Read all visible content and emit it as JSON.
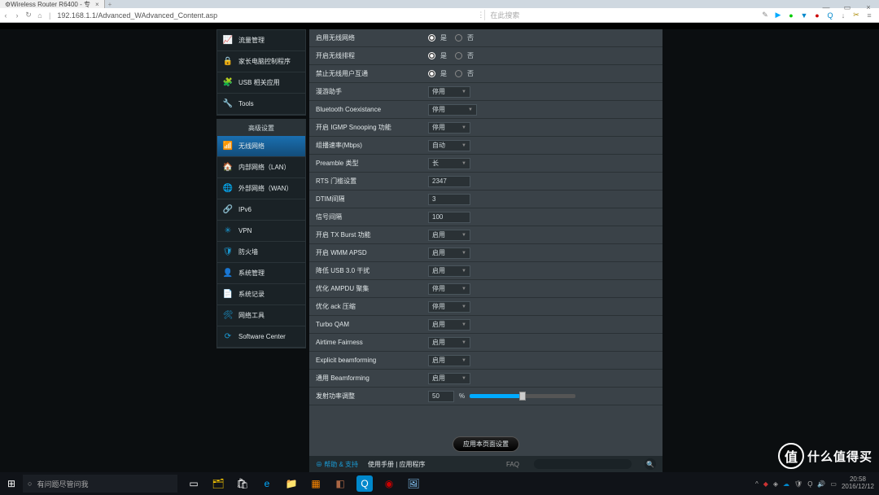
{
  "browser": {
    "tab_title": "Wireless Router R6400 - 专",
    "url": "192.168.1.1/Advanced_WAdvanced_Content.asp",
    "search_placeholder": "在此搜索"
  },
  "sidebar": {
    "group1": [
      {
        "icon": "📈",
        "label": "流量管理"
      },
      {
        "icon": "🔒",
        "label": "家长电脑控制程序"
      },
      {
        "icon": "🧩",
        "label": "USB 相关应用"
      },
      {
        "icon": "🔧",
        "label": "Tools"
      }
    ],
    "group2_header": "高级设置",
    "group2": [
      {
        "icon": "📶",
        "label": "无线网络",
        "active": true
      },
      {
        "icon": "🏠",
        "label": "内部网络（LAN）"
      },
      {
        "icon": "🌐",
        "label": "外部网络（WAN）"
      },
      {
        "icon": "🔗",
        "label": "IPv6"
      },
      {
        "icon": "✳",
        "label": "VPN"
      },
      {
        "icon": "🛡",
        "label": "防火墙"
      },
      {
        "icon": "👤",
        "label": "系统管理"
      },
      {
        "icon": "📄",
        "label": "系统记录"
      },
      {
        "icon": "🛠",
        "label": "网络工具"
      },
      {
        "icon": "⟳",
        "label": "Software Center"
      }
    ]
  },
  "settings": {
    "rows": [
      {
        "label": "启用无线网络",
        "type": "radio",
        "opts": [
          "是",
          "否"
        ],
        "sel": 0
      },
      {
        "label": "开启无线排程",
        "type": "radio",
        "opts": [
          "是",
          "否"
        ],
        "sel": 0
      },
      {
        "label": "禁止无线用户互通",
        "type": "radio",
        "opts": [
          "是",
          "否"
        ],
        "sel": 0
      },
      {
        "label": "漫游助手",
        "type": "select",
        "val": "停用"
      },
      {
        "label": "Bluetooth Coexistance",
        "type": "select",
        "val": "停用",
        "wide": true
      },
      {
        "label": "开启 IGMP Snooping 功能",
        "type": "select",
        "val": "停用"
      },
      {
        "label": "组播速率(Mbps)",
        "type": "select",
        "val": "自动"
      },
      {
        "label": "Preamble 类型",
        "type": "select",
        "val": "长"
      },
      {
        "label": "RTS 门槛设置",
        "type": "input",
        "val": "2347"
      },
      {
        "label": "DTIM间隔",
        "type": "input",
        "val": "3"
      },
      {
        "label": "信号间隔",
        "type": "input",
        "val": "100"
      },
      {
        "label": "开启 TX Burst 功能",
        "type": "select",
        "val": "启用"
      },
      {
        "label": "开启 WMM APSD",
        "type": "select",
        "val": "启用"
      },
      {
        "label": "降低 USB 3.0 干扰",
        "type": "select",
        "val": "启用"
      },
      {
        "label": "优化 AMPDU 聚集",
        "type": "select",
        "val": "停用"
      },
      {
        "label": "优化 ack 压缩",
        "type": "select",
        "val": "停用"
      },
      {
        "label": "Turbo QAM",
        "type": "select",
        "val": "启用"
      },
      {
        "label": "Airtime Fairness",
        "type": "select",
        "val": "启用"
      },
      {
        "label": "Explicit beamforming",
        "type": "select",
        "val": "启用"
      },
      {
        "label": "通用 Beamforming",
        "type": "select",
        "val": "启用"
      },
      {
        "label": "发射功率调整",
        "type": "slider",
        "val": "50",
        "unit": "%"
      }
    ],
    "apply": "应用本页面设置"
  },
  "footer": {
    "help": "⊕ 帮助 & 支持",
    "links": "使用手册 | 应用程序",
    "faq": "FAQ"
  },
  "taskbar": {
    "cortana": "有问题尽管问我",
    "time": "20:58",
    "date": "2016/12/12"
  },
  "watermark": "什么值得买"
}
